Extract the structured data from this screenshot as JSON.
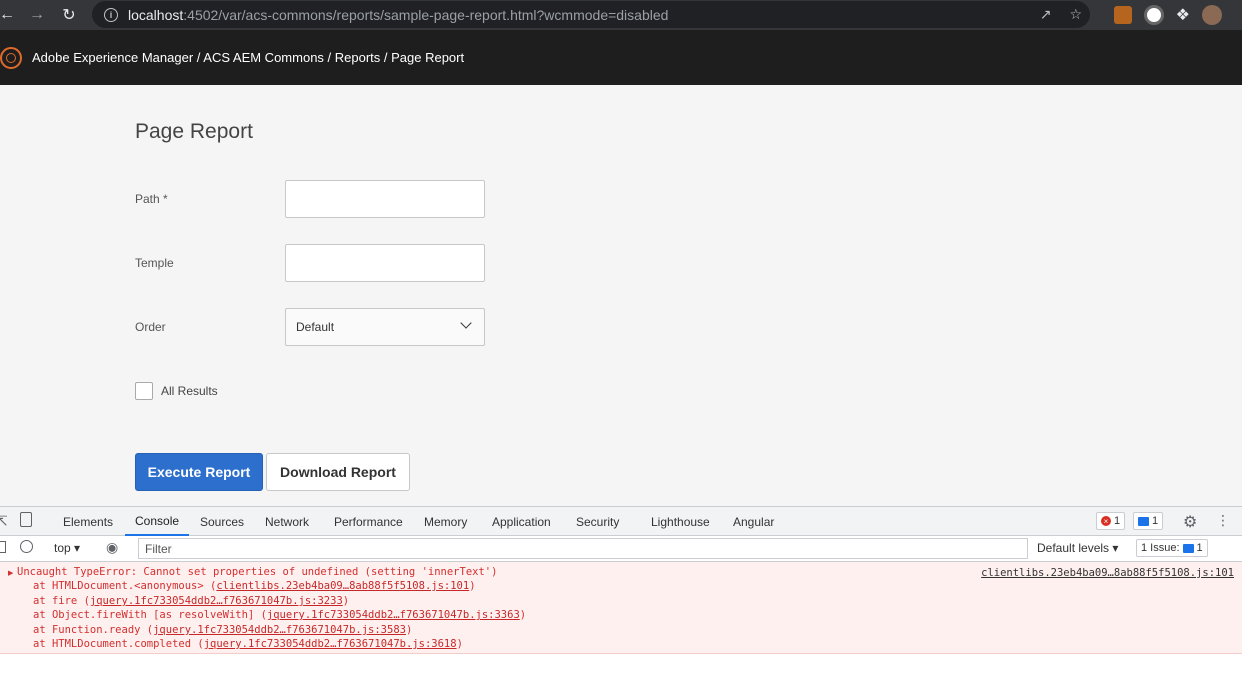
{
  "browser": {
    "url_host": "localhost",
    "url_rest": ":4502/var/acs-commons/reports/sample-page-report.html?wcmmode=disabled"
  },
  "header": {
    "breadcrumb": "Adobe Experience Manager / ACS AEM Commons / Reports / Page Report"
  },
  "page": {
    "title": "Page Report",
    "path_label": "Path *",
    "path_value": "",
    "template_label": "Temple",
    "template_value": "",
    "order_label": "Order",
    "order_value": "Default",
    "all_results_label": "All Results",
    "execute_label": "Execute Report",
    "download_label": "Download Report"
  },
  "devtools": {
    "tabs": [
      "Elements",
      "Console",
      "Sources",
      "Network",
      "Performance",
      "Memory",
      "Application",
      "Security",
      "Lighthouse",
      "Angular"
    ],
    "active_tab": "Console",
    "error_count": "1",
    "message_count": "1",
    "context": "top",
    "filter_placeholder": "Filter",
    "levels": "Default levels",
    "issues_label": "1 Issue:",
    "issues_count": "1",
    "error": {
      "message": "Uncaught TypeError: Cannot set properties of undefined (setting 'innerText')",
      "source": "clientlibs.23eb4ba09…8ab88f5f5108.js:101",
      "stack": [
        {
          "fn": "at HTMLDocument.<anonymous> (",
          "link": "clientlibs.23eb4ba09…8ab88f5f5108.js:101",
          "end": ")"
        },
        {
          "fn": "at fire (",
          "link": "jquery.1fc733054ddb2…f763671047b.js:3233",
          "end": ")"
        },
        {
          "fn": "at Object.fireWith [as resolveWith] (",
          "link": "jquery.1fc733054ddb2…f763671047b.js:3363",
          "end": ")"
        },
        {
          "fn": "at Function.ready (",
          "link": "jquery.1fc733054ddb2…f763671047b.js:3583",
          "end": ")"
        },
        {
          "fn": "at HTMLDocument.completed (",
          "link": "jquery.1fc733054ddb2…f763671047b.js:3618",
          "end": ")"
        }
      ]
    }
  }
}
